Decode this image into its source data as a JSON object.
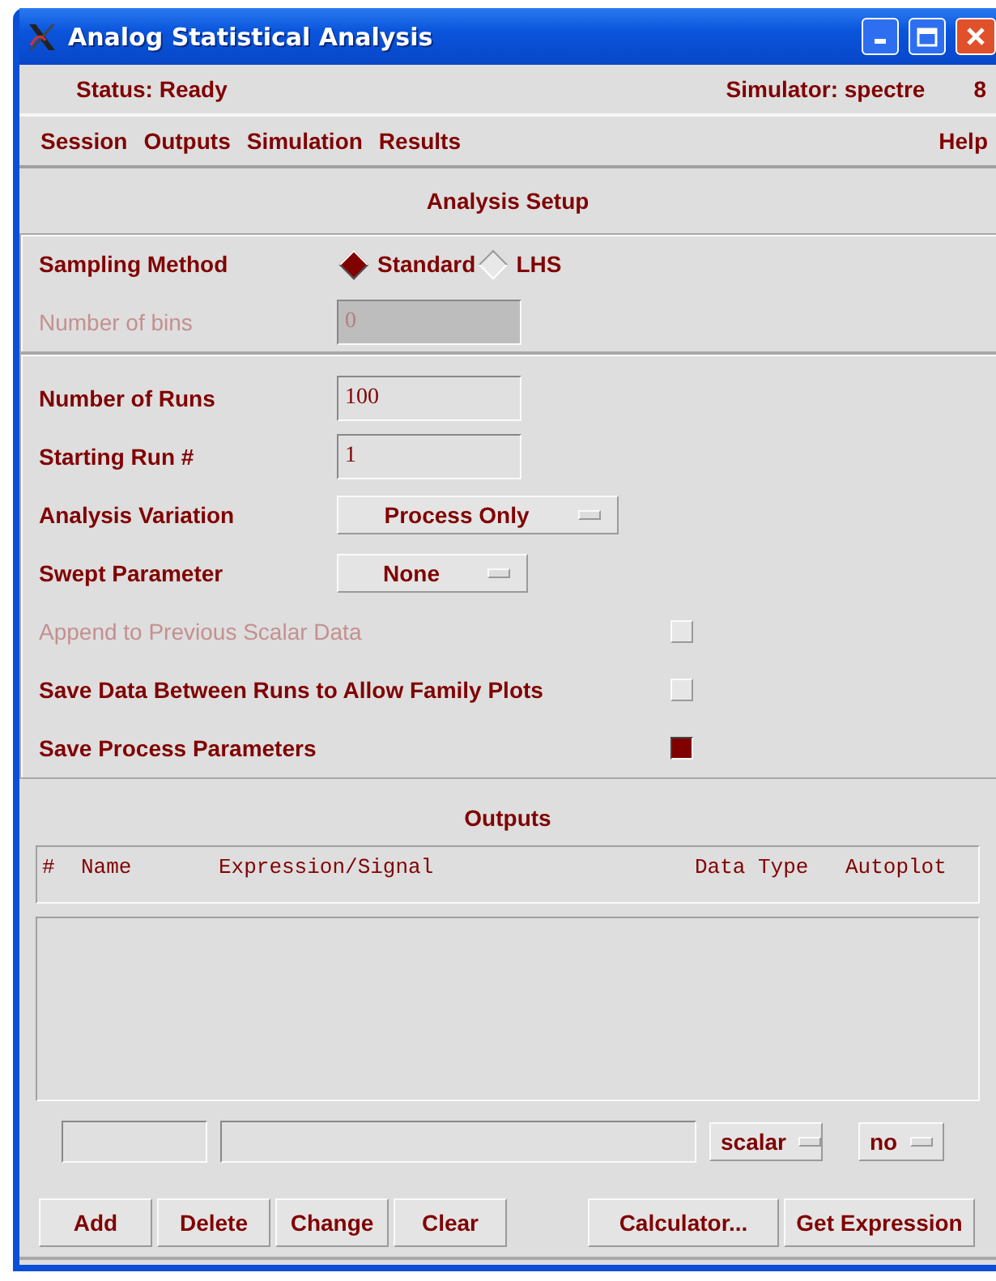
{
  "window": {
    "title": "Analog Statistical Analysis"
  },
  "status_bar": {
    "status": "Status: Ready",
    "simulator": "Simulator: spectre",
    "number": "8"
  },
  "menu": [
    "Session",
    "Outputs",
    "Simulation",
    "Results"
  ],
  "help_menu": "Help",
  "setup": {
    "title": "Analysis Setup",
    "groups": [
      [
        {
          "kind": "radio",
          "label": "Sampling Method",
          "disabled": false,
          "options": [
            {
              "label": "Standard",
              "selected": true
            },
            {
              "label": "LHS",
              "selected": false
            }
          ]
        },
        {
          "kind": "text",
          "label": "Number of bins",
          "value": "0",
          "disabled": true
        }
      ],
      [
        {
          "kind": "text",
          "label": "Number of Runs",
          "value": "100",
          "disabled": false
        },
        {
          "kind": "text",
          "label": "Starting Run #",
          "value": "1",
          "disabled": false
        },
        {
          "kind": "cycle",
          "label": "Analysis Variation",
          "value": "Process Only",
          "disabled": false
        },
        {
          "kind": "cycle",
          "label": "Swept Parameter",
          "value": "None",
          "disabled": false
        },
        {
          "kind": "check",
          "label": "Append to Previous Scalar Data",
          "checked": false,
          "disabled": true
        },
        {
          "kind": "check",
          "label": "Save Data Between Runs to Allow Family Plots",
          "checked": false,
          "disabled": false
        },
        {
          "kind": "check",
          "label": "Save Process Parameters",
          "checked": true,
          "disabled": false
        }
      ]
    ]
  },
  "outputs": {
    "title": "Outputs",
    "columns": [
      "#",
      "Name",
      "Expression/Signal",
      "Data Type",
      "Autoplot"
    ],
    "data_type": "scalar",
    "autoplot": "no"
  },
  "buttons_left": [
    "Add",
    "Delete",
    "Change",
    "Clear"
  ],
  "buttons_right": [
    "Calculator...",
    "Get Expression"
  ]
}
